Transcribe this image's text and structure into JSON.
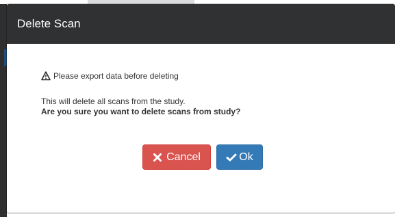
{
  "modal": {
    "title": "Delete Scan",
    "warning": "Please export data before deleting",
    "description": "This will delete all scans from the study.",
    "confirm_question": "Are you sure you want to delete scans from study?",
    "cancel_label": "Cancel",
    "ok_label": "Ok"
  },
  "icons": {
    "warning": "warning-triangle-icon",
    "cancel": "x-icon",
    "ok": "check-icon"
  },
  "colors": {
    "header_bg": "#2f3133",
    "cancel_bg": "#d9534f",
    "ok_bg": "#337ab7"
  }
}
